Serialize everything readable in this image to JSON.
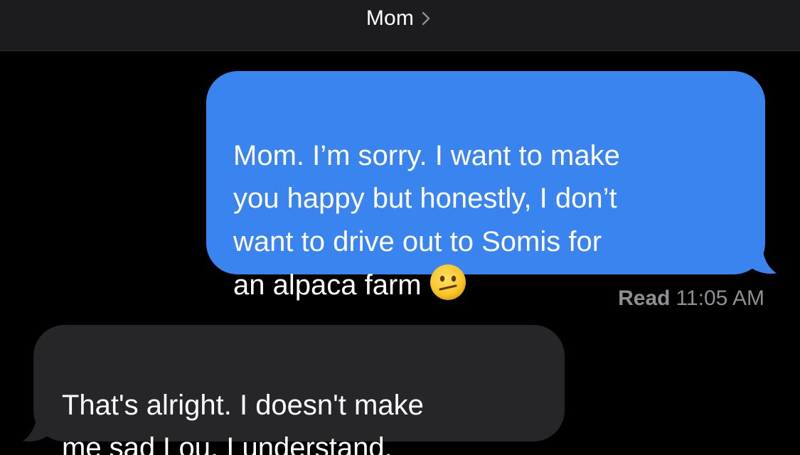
{
  "header": {
    "contact_name": "Mom"
  },
  "messages": [
    {
      "direction": "outgoing",
      "text": "Mom. I’m sorry. I want to make\nyou happy but honestly, I don’t\nwant to drive out to Somis for\nan alpaca farm",
      "emoji": "neutral-face-emoji"
    },
    {
      "direction": "incoming",
      "text": "That's alright. I doesn't make\nme sad Lou. I understand."
    }
  ],
  "receipt": {
    "status": "Read",
    "time": "11:05 AM"
  },
  "colors": {
    "outgoing_bubble": "#3a84f0",
    "incoming_bubble": "#262628",
    "header_bg": "#1c1c1e",
    "background": "#000000"
  }
}
